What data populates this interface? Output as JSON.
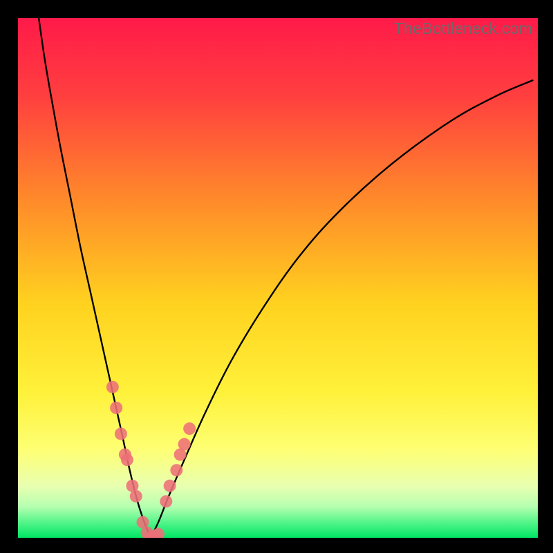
{
  "watermark": "TheBottleneck.com",
  "chart_data": {
    "type": "line",
    "title": "",
    "xlabel": "",
    "ylabel": "",
    "xlim": [
      0,
      100
    ],
    "ylim": [
      0,
      100
    ],
    "grid": false,
    "legend": false,
    "gradient_stops": [
      {
        "offset": 0.0,
        "color": "#ff1a49"
      },
      {
        "offset": 0.15,
        "color": "#ff3f3f"
      },
      {
        "offset": 0.35,
        "color": "#ff8a2a"
      },
      {
        "offset": 0.55,
        "color": "#ffd21f"
      },
      {
        "offset": 0.72,
        "color": "#fff13a"
      },
      {
        "offset": 0.83,
        "color": "#feff73"
      },
      {
        "offset": 0.9,
        "color": "#e9ffb0"
      },
      {
        "offset": 0.94,
        "color": "#b6ffb0"
      },
      {
        "offset": 0.97,
        "color": "#55f58a"
      },
      {
        "offset": 1.0,
        "color": "#00e565"
      }
    ],
    "series": [
      {
        "name": "left-curve",
        "color": "#000000",
        "x": [
          4,
          5,
          6,
          8,
          10,
          12,
          14,
          16,
          18,
          20,
          21.5,
          23,
          24.3,
          25.5
        ],
        "y": [
          100,
          93,
          87,
          76,
          66,
          56,
          47,
          38,
          29,
          20,
          13,
          7,
          3,
          0
        ]
      },
      {
        "name": "right-curve",
        "color": "#000000",
        "x": [
          25.5,
          27,
          29,
          32,
          36,
          41,
          47,
          54,
          62,
          72,
          83,
          92,
          99
        ],
        "y": [
          0,
          3,
          8,
          15,
          24,
          34,
          44,
          54,
          63,
          72,
          80,
          85,
          88
        ]
      },
      {
        "name": "markers-left",
        "type": "scatter",
        "color": "#ed6f78",
        "x": [
          18.2,
          18.9,
          19.8,
          20.6,
          21.0,
          22.0,
          22.7,
          24.0,
          24.8
        ],
        "y": [
          29,
          25,
          20,
          16,
          15,
          10,
          8,
          3,
          1
        ]
      },
      {
        "name": "markers-bottom",
        "type": "scatter",
        "color": "#ed6f78",
        "x": [
          25.5,
          26.3,
          27.0
        ],
        "y": [
          0,
          0.4,
          0.7
        ]
      },
      {
        "name": "markers-right",
        "type": "scatter",
        "color": "#ed6f78",
        "x": [
          28.5,
          29.2,
          30.5,
          31.2,
          32.0,
          33.0
        ],
        "y": [
          7,
          10,
          13,
          16,
          18,
          21
        ]
      }
    ]
  }
}
